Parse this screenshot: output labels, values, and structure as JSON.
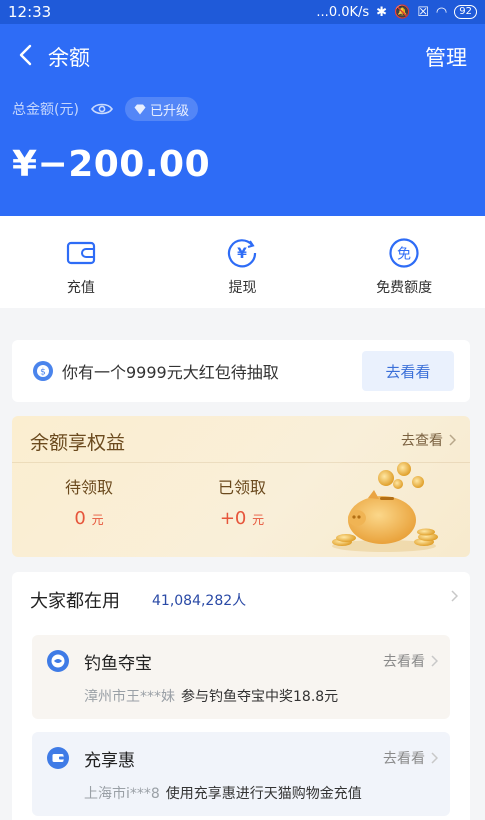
{
  "status_bar": {
    "time": "12:33",
    "network_speed": "...0.0K/s",
    "battery": "92"
  },
  "header": {
    "title": "余额",
    "manage_label": "管理",
    "total_label": "总金额(元)",
    "upgraded_badge": "已升级",
    "amount": "¥−200.00"
  },
  "actions": [
    {
      "label": "充值",
      "icon": "wallet-icon"
    },
    {
      "label": "提现",
      "icon": "yen-transfer-icon"
    },
    {
      "label": "免费额度",
      "icon": "free-quota-icon"
    }
  ],
  "promo": {
    "text": "你有一个9999元大红包待抽取",
    "button_label": "去看看"
  },
  "benefits": {
    "title": "余额享权益",
    "link_label": "去查看",
    "pending_label": "待领取",
    "pending_value": "0",
    "claimed_label": "已领取",
    "claimed_value": "+0",
    "unit": "元"
  },
  "popular": {
    "title": "大家都在用",
    "count": "41,084,282人",
    "services": [
      {
        "name": "钓鱼夺宝",
        "link_label": "去看看",
        "location": "漳州市王***妹",
        "description": "参与钓鱼夺宝中奖18.8元"
      },
      {
        "name": "充享惠",
        "link_label": "去看看",
        "location": "上海市i***8",
        "description": "使用充享惠进行天猫购物金充值"
      }
    ]
  },
  "colors": {
    "primary": "#2E6CF6",
    "accent_red": "#E6553B"
  }
}
